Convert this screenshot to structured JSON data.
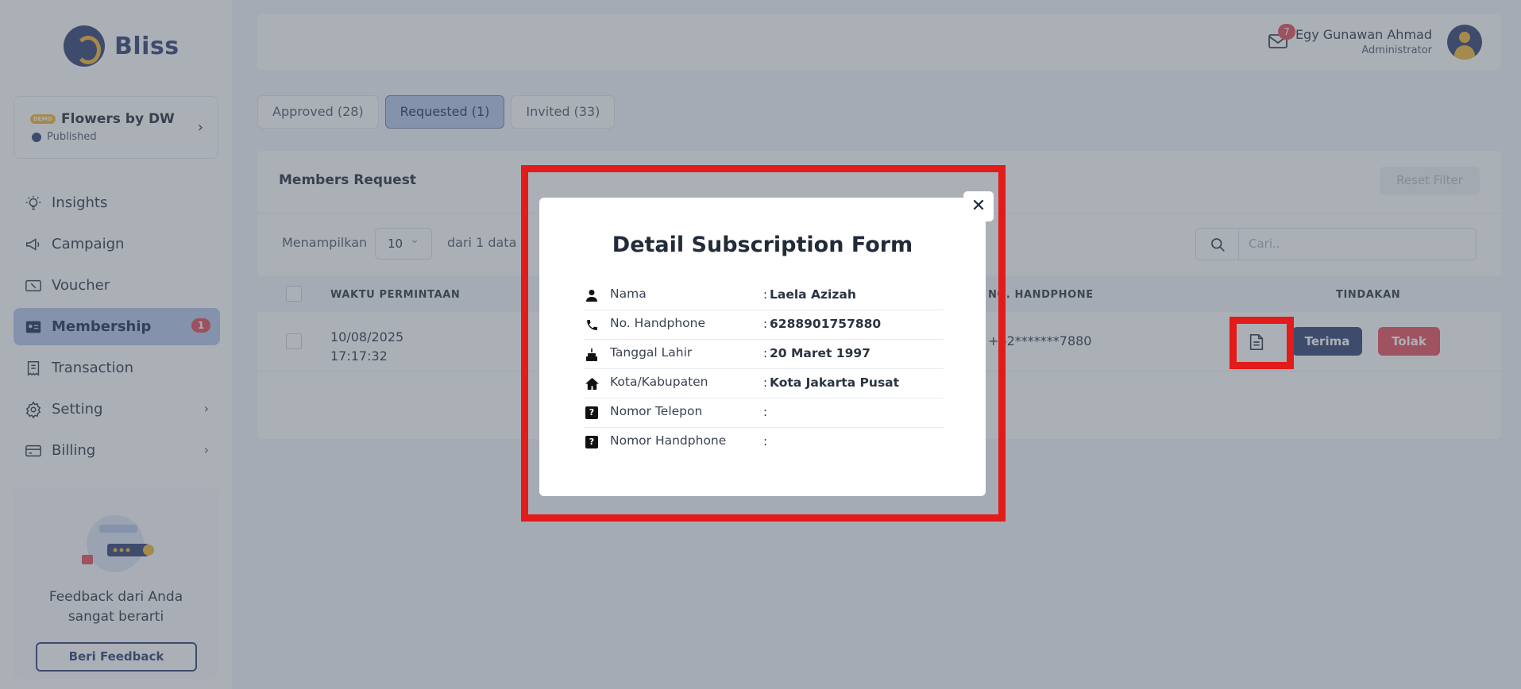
{
  "brand": {
    "name": "Bliss"
  },
  "store": {
    "badge": "DEMO",
    "name": "Flowers by DW",
    "status": "Published"
  },
  "sidebar": {
    "items": [
      {
        "label": "Insights",
        "icon": "lightbulb-icon"
      },
      {
        "label": "Campaign",
        "icon": "megaphone-icon"
      },
      {
        "label": "Voucher",
        "icon": "voucher-icon"
      },
      {
        "label": "Membership",
        "icon": "membership-card-icon",
        "badge": "1",
        "active": true
      },
      {
        "label": "Transaction",
        "icon": "receipt-icon"
      },
      {
        "label": "Setting",
        "icon": "gear-icon",
        "chevron": true
      },
      {
        "label": "Billing",
        "icon": "credit-card-icon",
        "chevron": true
      }
    ]
  },
  "feedback": {
    "text_line1": "Feedback dari Anda",
    "text_line2": "sangat berarti",
    "button": "Beri Feedback"
  },
  "header": {
    "mail_count": "7",
    "user_name": "Egy Gunawan Ahmad",
    "user_role": "Administrator"
  },
  "tabs": [
    {
      "label": "Approved (28)"
    },
    {
      "label": "Requested (1)",
      "active": true
    },
    {
      "label": "Invited (33)"
    }
  ],
  "members": {
    "title": "Members Request",
    "reset_button": "Reset Filter",
    "show_label": "Menampilkan",
    "page_size": "10",
    "count_label": "dari 1 data",
    "search_placeholder": "Cari..",
    "columns": {
      "time": "WAKTU PERMINTAAN",
      "phone": "NO. HANDPHONE",
      "actions": "TINDAKAN"
    },
    "row": {
      "date": "10/08/2025",
      "time": "17:17:32",
      "phone": "+62*******7880",
      "accept": "Terima",
      "reject": "Tolak"
    }
  },
  "modal": {
    "title": "Detail Subscription Form",
    "close": "✕",
    "fields": [
      {
        "icon": "person-icon",
        "label": "Nama",
        "value": "Laela Azizah"
      },
      {
        "icon": "phone-icon",
        "label": "No. Handphone",
        "value": "6288901757880"
      },
      {
        "icon": "cake-icon",
        "label": "Tanggal Lahir",
        "value": "20 Maret 1997"
      },
      {
        "icon": "house-icon",
        "label": "Kota/Kabupaten",
        "value": "Kota Jakarta Pusat"
      },
      {
        "icon": "question-icon",
        "label": "Nomor Telepon",
        "value": ""
      },
      {
        "icon": "question-icon",
        "label": "Nomor Handphone",
        "value": ""
      }
    ]
  },
  "colors": {
    "primary": "#2f3f72",
    "accent": "#f2b731",
    "danger": "#e84c56",
    "highlight": "#e21b1b"
  }
}
